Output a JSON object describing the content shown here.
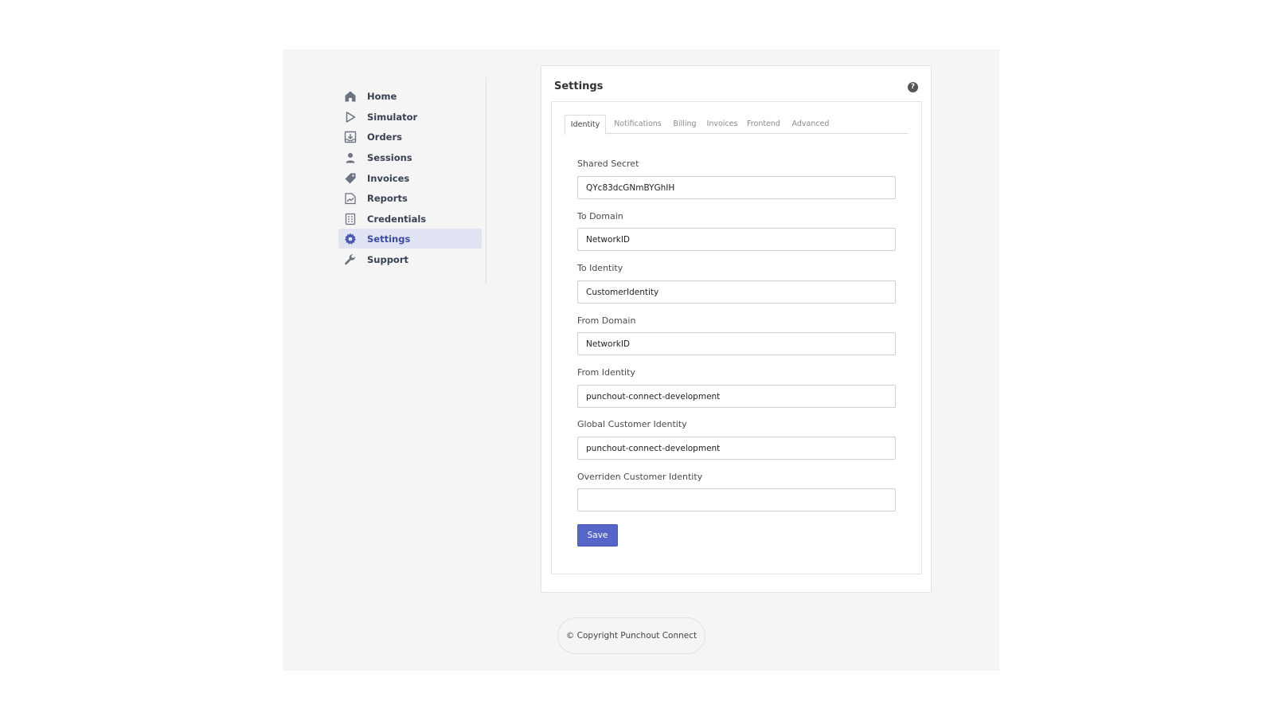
{
  "sidebar": {
    "items": [
      {
        "label": "Home",
        "icon": "home-icon"
      },
      {
        "label": "Simulator",
        "icon": "play-icon"
      },
      {
        "label": "Orders",
        "icon": "inbox-download-icon"
      },
      {
        "label": "Sessions",
        "icon": "user-icon"
      },
      {
        "label": "Invoices",
        "icon": "tag-icon"
      },
      {
        "label": "Reports",
        "icon": "report-chart-icon"
      },
      {
        "label": "Credentials",
        "icon": "document-list-icon"
      },
      {
        "label": "Settings",
        "icon": "gear-icon",
        "active": true
      },
      {
        "label": "Support",
        "icon": "wrench-icon"
      }
    ]
  },
  "card": {
    "title": "Settings",
    "help": "?"
  },
  "tabs": [
    "Identity",
    "Notifications",
    "Billing",
    "Invoices",
    "Frontend",
    "Advanced"
  ],
  "active_tab": "Identity",
  "form": {
    "shared_secret": {
      "label": "Shared Secret",
      "value": "QYc83dcGNmBYGhIH"
    },
    "to_domain": {
      "label": "To Domain",
      "value": "NetworkID"
    },
    "to_identity": {
      "label": "To Identity",
      "value": "CustomerIdentity"
    },
    "from_domain": {
      "label": "From Domain",
      "value": "NetworkID"
    },
    "from_identity": {
      "label": "From Identity",
      "value": "punchout-connect-development"
    },
    "global_customer_identity": {
      "label": "Global Customer Identity",
      "value": "punchout-connect-development"
    },
    "overriden_customer_identity": {
      "label": "Overriden Customer Identity",
      "value": ""
    },
    "save_label": "Save"
  },
  "footer": {
    "copyright": "© Copyright Punchout Connect"
  },
  "colors": {
    "accent": "#5566c8",
    "active_nav_bg": "#e0e3f2",
    "active_nav_text": "#3b4a9e",
    "icon": "#6b7280"
  }
}
